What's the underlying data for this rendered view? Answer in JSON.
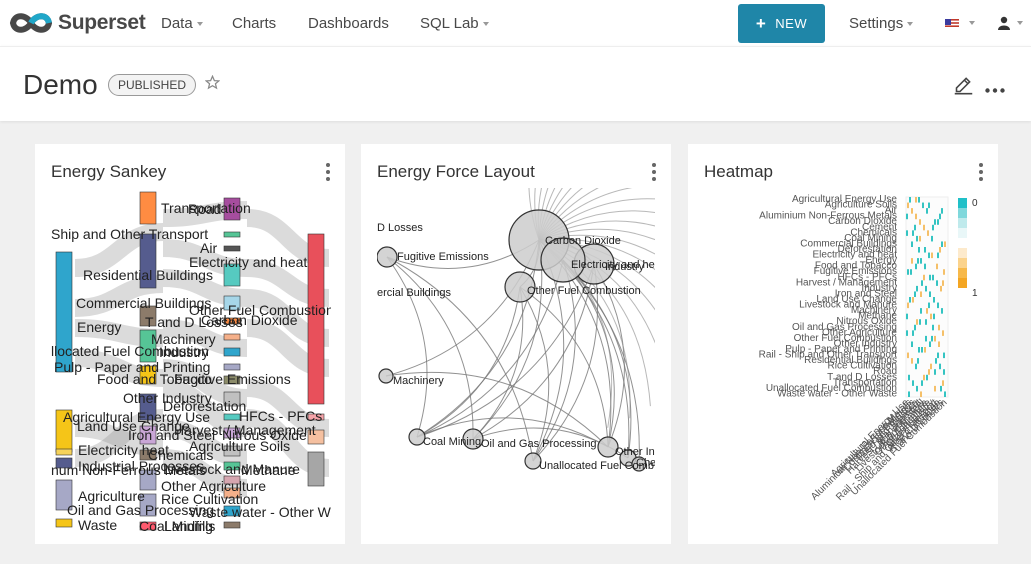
{
  "brand": {
    "name": "Superset"
  },
  "nav": {
    "data": "Data",
    "charts": "Charts",
    "dashboards": "Dashboards",
    "sql_lab": "SQL Lab",
    "new_button": "NEW",
    "settings": "Settings"
  },
  "dashboard": {
    "title": "Demo",
    "status": "PUBLISHED"
  },
  "cards": [
    {
      "title": "Energy Sankey",
      "labels": [
        "Transportation",
        "Road",
        "Ship and Other Transport",
        "Air",
        "Electricity and heat",
        "Residential Buildings",
        "Commercial Buildings",
        "Other Fuel Combustion",
        "Energy",
        "T and D Losses",
        "Carbon Dioxide",
        "Machinery",
        "llocated Fuel Combustion",
        "Industry",
        "Pulp - Paper and Printing",
        "Food and Tobacco",
        "Fugitive Emissions",
        "Other Industry",
        "Deforestation",
        "Agricultural Energy Use",
        "HFCs - PFCs",
        "Land Use Change",
        "Harvest / Management",
        "Iron and Steel",
        "Nitrous Oxide",
        "Electricity heat",
        "Chemicals",
        "Agriculture Soils",
        "Industrial Processes",
        "num Non-Ferrous Metals",
        "Livestock and Manure",
        "Methane",
        "Other Agriculture",
        "Agriculture",
        "Rice Cultivation",
        "Oil and Gas Processing",
        "Waste water - Other Waste",
        "Waste",
        "Coal Mining",
        "Landfills"
      ]
    },
    {
      "title": "Energy Force Layout",
      "labels": [
        "D Losses",
        "Carbon Dioxide",
        "Fugitive Emissions",
        "Electricity and heat",
        "Industry",
        "ercial Buildings",
        "Other Fuel Combustion",
        "Machinery",
        "Coal Mining",
        "Oil and Gas Processing",
        "Other In",
        "Unallocated Fuel Comb",
        "Che"
      ]
    },
    {
      "title": "Heatmap",
      "legend": [
        "0",
        "1"
      ],
      "row_labels": [
        "Agricultural Energy Use",
        "Agriculture Soils",
        "Air",
        "Aluminium Non-Ferrous Metals",
        "Carbon Dioxide",
        "Cement",
        "Chemicals",
        "Coal Mining",
        "Commercial Buildings",
        "Deforestation",
        "Electricity and heat",
        "Energy",
        "Food and Tobacco",
        "Fugitive Emissions",
        "HFCs - PFCs",
        "Harvest / Management",
        "Industry",
        "Iron and Steel",
        "Land Use Change",
        "Livestock and Manure",
        "Machinery",
        "Methane",
        "Nitrous Oxide",
        "Oil and Gas Processing",
        "Other Agriculture",
        "Other Fuel Combustion",
        "Other Industry",
        "Pulp - Paper and Printing",
        "Rail - Ship and Other Transport",
        "Residential Buildings",
        "Rice Cultivation",
        "Road",
        "T and D Losses",
        "Transportation",
        "Unallocated Fuel Combustion",
        "Waste water - Other Waste"
      ],
      "col_labels": [
        "Agricultural Energy Use",
        "Aluminium Non-Ferrous Metals",
        "Commercial Buildings",
        "Food and Tobacco",
        "Harvest / Management",
        "Iron and Steel",
        "Livestock and Manure",
        "Other Agriculture",
        "Other Industry",
        "Rail - Ship and Other Transport",
        "Rice Cultivation",
        "T and D Losses",
        "Unallocated Fuel Combustion"
      ]
    }
  ],
  "colors": {
    "brand_blue": "#1f86a8",
    "accent": "#20a7c9",
    "logo_gray": "#484848"
  }
}
